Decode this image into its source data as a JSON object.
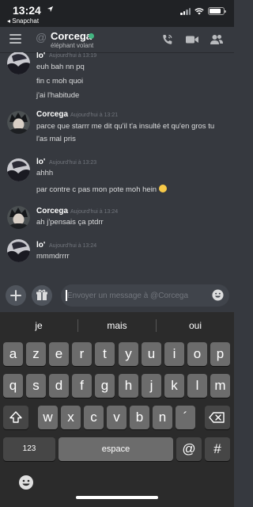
{
  "status_bar": {
    "time": "13:24",
    "back_app": "◂ Snapchat"
  },
  "header": {
    "channel_name": "Corcega",
    "channel_subtitle": "éléphant volant",
    "at_symbol": "@",
    "online_color": "#43b581"
  },
  "messages": [
    {
      "author": "lo'",
      "timestamp": "Aujourd'hui à 13:19",
      "lines": [
        "euh bah nn pq",
        "fin c moh quoi",
        "j'ai l'habitude"
      ]
    },
    {
      "author": "Corcega",
      "timestamp": "Aujourd'hui à 13:21",
      "lines": [
        "parce que starrr me dit qu'il t'a insulté et qu'en gros tu",
        "l'as mal pris"
      ]
    },
    {
      "author": "lo'",
      "timestamp": "Aujourd'hui à 13:23",
      "lines": [
        "ahhh",
        "par contre c pas mon pote moh hein"
      ]
    },
    {
      "author": "Corcega",
      "timestamp": "Aujourd'hui à 13:24",
      "lines": [
        "ah j'pensais ça ptdrr"
      ]
    },
    {
      "author": "lo'",
      "timestamp": "Aujourd'hui à 13:24",
      "lines": [
        "mmmdrrrr"
      ]
    }
  ],
  "composer": {
    "placeholder": "Envoyer un message à @Corcega"
  },
  "keyboard": {
    "suggestions": [
      "je",
      "mais",
      "oui"
    ],
    "row1": [
      "a",
      "z",
      "e",
      "r",
      "t",
      "y",
      "u",
      "i",
      "o",
      "p"
    ],
    "row2": [
      "q",
      "s",
      "d",
      "f",
      "g",
      "h",
      "j",
      "k",
      "l",
      "m"
    ],
    "row3": [
      "w",
      "x",
      "c",
      "v",
      "b",
      "n",
      "´"
    ],
    "numbers_label": "123",
    "space_label": "espace",
    "at_label": "@",
    "hash_label": "#"
  },
  "icons": {
    "menu": "hamburger-icon",
    "call": "phone-icon",
    "video": "video-camera-icon",
    "members": "members-icon",
    "add": "plus-icon",
    "gift": "gift-icon",
    "emoji": "emoji-icon",
    "shift": "shift-icon",
    "delete": "backspace-icon"
  }
}
